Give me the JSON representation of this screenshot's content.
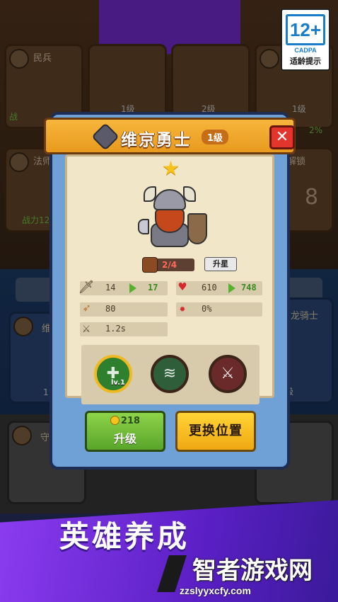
{
  "age_rating": {
    "number": "12+",
    "org": "CADPA",
    "tip": "适龄提示"
  },
  "background": {
    "cards": [
      {
        "name": "民兵",
        "footer": "战"
      },
      {
        "name": "",
        "footer": "1级"
      },
      {
        "name": "",
        "footer": "2级"
      },
      {
        "name": "",
        "footer": "1级"
      },
      {
        "name": "法师",
        "footer": "战力12"
      },
      {
        "name": "",
        "footer": ""
      },
      {
        "name": "",
        "footer": ""
      },
      {
        "name": "未解锁",
        "footer": "8"
      },
      {
        "name": "维",
        "footer": "1"
      },
      {
        "name": "",
        "footer": ""
      },
      {
        "name": "",
        "footer": ""
      },
      {
        "name": "龙骑士",
        "footer": "级"
      },
      {
        "name": "守",
        "footer": ""
      },
      {
        "name": "",
        "footer": ""
      },
      {
        "name": "",
        "footer": ""
      },
      {
        "name": "",
        "footer": ""
      }
    ],
    "side_text": "2%"
  },
  "modal": {
    "title": "维京勇士",
    "level": "1级",
    "close": "✕",
    "stars": "★",
    "shards": {
      "progress": "2/4",
      "button": "升星"
    },
    "stats": {
      "attack": {
        "icon": "sword-icon",
        "current": "14",
        "next": "17"
      },
      "hp": {
        "icon": "heart-icon",
        "current": "610",
        "next": "748"
      },
      "range": {
        "icon": "bow-icon",
        "current": "80"
      },
      "crit": {
        "icon": "crit-icon",
        "current": "0%"
      },
      "speed": {
        "icon": "wing-sword-icon",
        "current": "1.2s"
      }
    },
    "skills": [
      {
        "name": "heal-skill",
        "glyph": "✚",
        "level": "lv.1"
      },
      {
        "name": "wave-skill",
        "glyph": "≋",
        "level": ""
      },
      {
        "name": "strike-skill",
        "glyph": "⚔",
        "level": ""
      }
    ],
    "upgrade": {
      "cost": "218",
      "label": "升级"
    },
    "swap": {
      "label": "更换位置"
    }
  },
  "promo": {
    "title": "英雄养成",
    "subtitle": ""
  },
  "watermark": {
    "title": "智者游戏网",
    "url": "zzslyyxcfy.com"
  },
  "colors": {
    "header_orange": "#f7b63c",
    "parchment": "#f2e6c8",
    "upgrade_green": "#8ed44a",
    "swap_yellow": "#ffd535",
    "close_red": "#e2352b",
    "promo_purple": "#8b3cf0"
  }
}
